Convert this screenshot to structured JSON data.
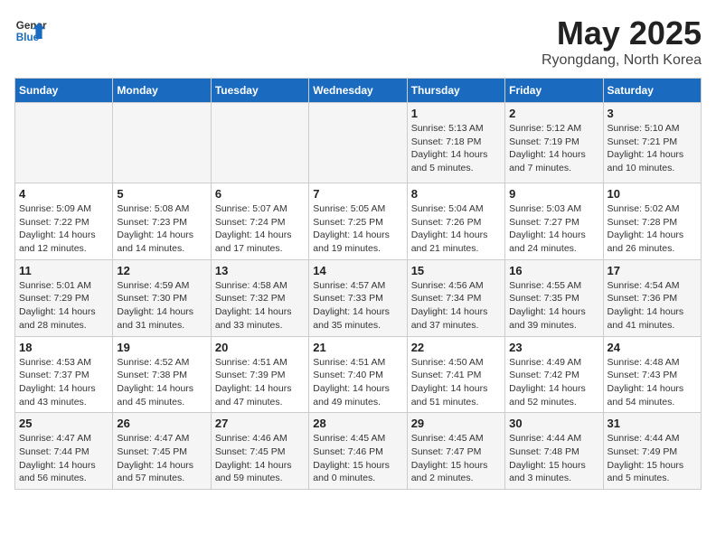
{
  "header": {
    "logo_line1": "General",
    "logo_line2": "Blue",
    "main_title": "May 2025",
    "subtitle": "Ryongdang, North Korea"
  },
  "days_of_week": [
    "Sunday",
    "Monday",
    "Tuesday",
    "Wednesday",
    "Thursday",
    "Friday",
    "Saturday"
  ],
  "weeks": [
    [
      {
        "day": "",
        "info": ""
      },
      {
        "day": "",
        "info": ""
      },
      {
        "day": "",
        "info": ""
      },
      {
        "day": "",
        "info": ""
      },
      {
        "day": "1",
        "info": "Sunrise: 5:13 AM\nSunset: 7:18 PM\nDaylight: 14 hours\nand 5 minutes."
      },
      {
        "day": "2",
        "info": "Sunrise: 5:12 AM\nSunset: 7:19 PM\nDaylight: 14 hours\nand 7 minutes."
      },
      {
        "day": "3",
        "info": "Sunrise: 5:10 AM\nSunset: 7:21 PM\nDaylight: 14 hours\nand 10 minutes."
      }
    ],
    [
      {
        "day": "4",
        "info": "Sunrise: 5:09 AM\nSunset: 7:22 PM\nDaylight: 14 hours\nand 12 minutes."
      },
      {
        "day": "5",
        "info": "Sunrise: 5:08 AM\nSunset: 7:23 PM\nDaylight: 14 hours\nand 14 minutes."
      },
      {
        "day": "6",
        "info": "Sunrise: 5:07 AM\nSunset: 7:24 PM\nDaylight: 14 hours\nand 17 minutes."
      },
      {
        "day": "7",
        "info": "Sunrise: 5:05 AM\nSunset: 7:25 PM\nDaylight: 14 hours\nand 19 minutes."
      },
      {
        "day": "8",
        "info": "Sunrise: 5:04 AM\nSunset: 7:26 PM\nDaylight: 14 hours\nand 21 minutes."
      },
      {
        "day": "9",
        "info": "Sunrise: 5:03 AM\nSunset: 7:27 PM\nDaylight: 14 hours\nand 24 minutes."
      },
      {
        "day": "10",
        "info": "Sunrise: 5:02 AM\nSunset: 7:28 PM\nDaylight: 14 hours\nand 26 minutes."
      }
    ],
    [
      {
        "day": "11",
        "info": "Sunrise: 5:01 AM\nSunset: 7:29 PM\nDaylight: 14 hours\nand 28 minutes."
      },
      {
        "day": "12",
        "info": "Sunrise: 4:59 AM\nSunset: 7:30 PM\nDaylight: 14 hours\nand 31 minutes."
      },
      {
        "day": "13",
        "info": "Sunrise: 4:58 AM\nSunset: 7:32 PM\nDaylight: 14 hours\nand 33 minutes."
      },
      {
        "day": "14",
        "info": "Sunrise: 4:57 AM\nSunset: 7:33 PM\nDaylight: 14 hours\nand 35 minutes."
      },
      {
        "day": "15",
        "info": "Sunrise: 4:56 AM\nSunset: 7:34 PM\nDaylight: 14 hours\nand 37 minutes."
      },
      {
        "day": "16",
        "info": "Sunrise: 4:55 AM\nSunset: 7:35 PM\nDaylight: 14 hours\nand 39 minutes."
      },
      {
        "day": "17",
        "info": "Sunrise: 4:54 AM\nSunset: 7:36 PM\nDaylight: 14 hours\nand 41 minutes."
      }
    ],
    [
      {
        "day": "18",
        "info": "Sunrise: 4:53 AM\nSunset: 7:37 PM\nDaylight: 14 hours\nand 43 minutes."
      },
      {
        "day": "19",
        "info": "Sunrise: 4:52 AM\nSunset: 7:38 PM\nDaylight: 14 hours\nand 45 minutes."
      },
      {
        "day": "20",
        "info": "Sunrise: 4:51 AM\nSunset: 7:39 PM\nDaylight: 14 hours\nand 47 minutes."
      },
      {
        "day": "21",
        "info": "Sunrise: 4:51 AM\nSunset: 7:40 PM\nDaylight: 14 hours\nand 49 minutes."
      },
      {
        "day": "22",
        "info": "Sunrise: 4:50 AM\nSunset: 7:41 PM\nDaylight: 14 hours\nand 51 minutes."
      },
      {
        "day": "23",
        "info": "Sunrise: 4:49 AM\nSunset: 7:42 PM\nDaylight: 14 hours\nand 52 minutes."
      },
      {
        "day": "24",
        "info": "Sunrise: 4:48 AM\nSunset: 7:43 PM\nDaylight: 14 hours\nand 54 minutes."
      }
    ],
    [
      {
        "day": "25",
        "info": "Sunrise: 4:47 AM\nSunset: 7:44 PM\nDaylight: 14 hours\nand 56 minutes."
      },
      {
        "day": "26",
        "info": "Sunrise: 4:47 AM\nSunset: 7:45 PM\nDaylight: 14 hours\nand 57 minutes."
      },
      {
        "day": "27",
        "info": "Sunrise: 4:46 AM\nSunset: 7:45 PM\nDaylight: 14 hours\nand 59 minutes."
      },
      {
        "day": "28",
        "info": "Sunrise: 4:45 AM\nSunset: 7:46 PM\nDaylight: 15 hours\nand 0 minutes."
      },
      {
        "day": "29",
        "info": "Sunrise: 4:45 AM\nSunset: 7:47 PM\nDaylight: 15 hours\nand 2 minutes."
      },
      {
        "day": "30",
        "info": "Sunrise: 4:44 AM\nSunset: 7:48 PM\nDaylight: 15 hours\nand 3 minutes."
      },
      {
        "day": "31",
        "info": "Sunrise: 4:44 AM\nSunset: 7:49 PM\nDaylight: 15 hours\nand 5 minutes."
      }
    ]
  ]
}
